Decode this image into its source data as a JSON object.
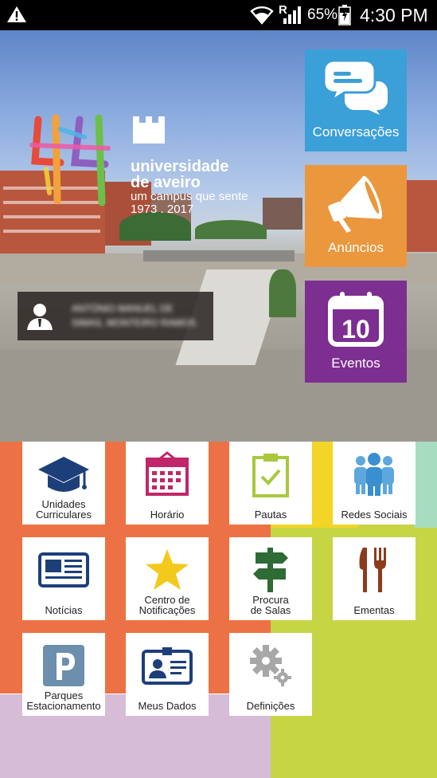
{
  "status_bar": {
    "roaming": "R",
    "battery": "65%",
    "time": "4:30 PM"
  },
  "header": {
    "logo_line1": "universidade",
    "logo_line2": "de aveiro",
    "logo_line3": "um campus que sente",
    "logo_line4": "1973 . 2017",
    "user_line1": "ANTÓNIO MANUEL DE",
    "user_line2": "SIMAS, MONTEIRO RAMOS"
  },
  "big_tiles": [
    {
      "label": "Conversações",
      "color": "#3b9fd8"
    },
    {
      "label": "Anúncios",
      "color": "#eb973d"
    },
    {
      "label": "Eventos",
      "color": "#7d2e91",
      "day": "10"
    }
  ],
  "tiles": {
    "unidades": {
      "line1": "Unidades",
      "line2": "Curriculares"
    },
    "horario": {
      "line1": "Horário"
    },
    "pautas": {
      "line1": "Pautas"
    },
    "redes": {
      "line1": "Redes Sociais"
    },
    "noticias": {
      "line1": "Notícias"
    },
    "centro": {
      "line1": "Centro de",
      "line2": "Notificações"
    },
    "procura": {
      "line1": "Procura",
      "line2": "de Salas"
    },
    "ementas": {
      "line1": "Ementas"
    },
    "parques": {
      "line1": "Parques",
      "line2": "Estacionamento"
    },
    "dados": {
      "line1": "Meus Dados"
    },
    "definicoes": {
      "line1": "Definições"
    }
  },
  "colors": {
    "orange": "#ec7245",
    "yellow": "#f2d526",
    "green_light": "#a8dcc1",
    "lime": "#c6d544",
    "lilac": "#d6bcd7",
    "navy": "#1d3f79",
    "magenta": "#c0266a"
  },
  "icons": [
    "warning-icon",
    "wifi-icon",
    "signal-icon",
    "battery-icon",
    "user-icon",
    "chat-icon",
    "megaphone-icon",
    "calendar-icon",
    "graduation-cap-icon",
    "schedule-icon",
    "clipboard-check-icon",
    "people-icon",
    "newspaper-icon",
    "star-icon",
    "signpost-icon",
    "fork-knife-icon",
    "parking-icon",
    "id-card-icon",
    "gears-icon"
  ]
}
